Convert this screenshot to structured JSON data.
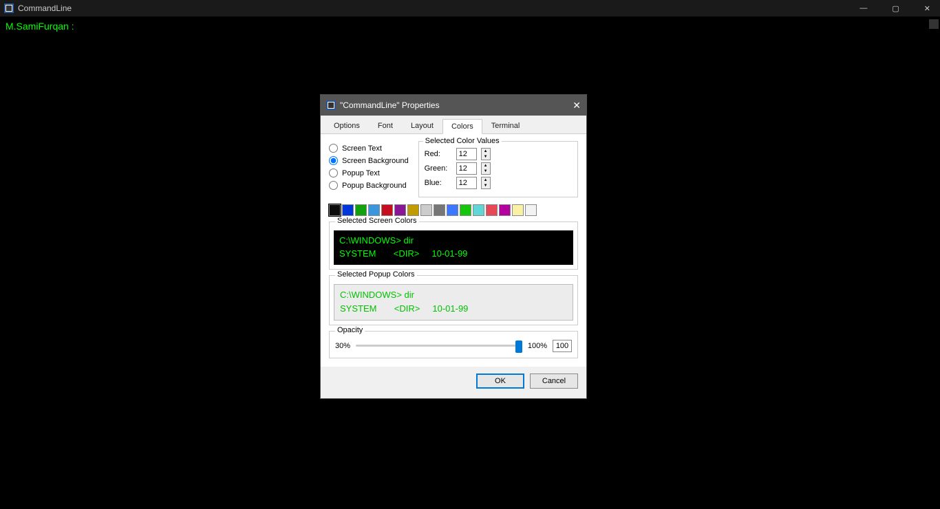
{
  "window": {
    "title": "CommandLine",
    "prompt": "M.SamiFurqan :"
  },
  "dialog": {
    "title": "\"CommandLine\" Properties",
    "tabs": [
      "Options",
      "Font",
      "Layout",
      "Colors",
      "Terminal"
    ],
    "activeTab": "Colors",
    "radios": {
      "screenText": "Screen Text",
      "screenBackground": "Screen Background",
      "popupText": "Popup Text",
      "popupBackground": "Popup Background",
      "selected": "screenBackground"
    },
    "colorValues": {
      "legend": "Selected Color Values",
      "redLabel": "Red:",
      "greenLabel": "Green:",
      "blueLabel": "Blue:",
      "red": "12",
      "green": "12",
      "blue": "12"
    },
    "palette": [
      "#0c0c0c",
      "#0037da",
      "#13a10e",
      "#3a96dd",
      "#c50f1f",
      "#881798",
      "#c19c00",
      "#cccccc",
      "#767676",
      "#3b78ff",
      "#16c60c",
      "#61d6d6",
      "#e74856",
      "#b4009e",
      "#f9f1a5",
      "#f2f2f2"
    ],
    "selectedPaletteIndex": 0,
    "screenPreview": {
      "legend": "Selected Screen Colors",
      "line1": "C:\\WINDOWS> dir",
      "line2": "SYSTEM       <DIR>     10-01-99"
    },
    "popupPreview": {
      "legend": "Selected Popup Colors",
      "line1": "C:\\WINDOWS> dir",
      "line2": "SYSTEM       <DIR>     10-01-99"
    },
    "opacity": {
      "legend": "Opacity",
      "minLabel": "30%",
      "maxLabel": "100%",
      "value": "100"
    },
    "buttons": {
      "ok": "OK",
      "cancel": "Cancel"
    }
  }
}
